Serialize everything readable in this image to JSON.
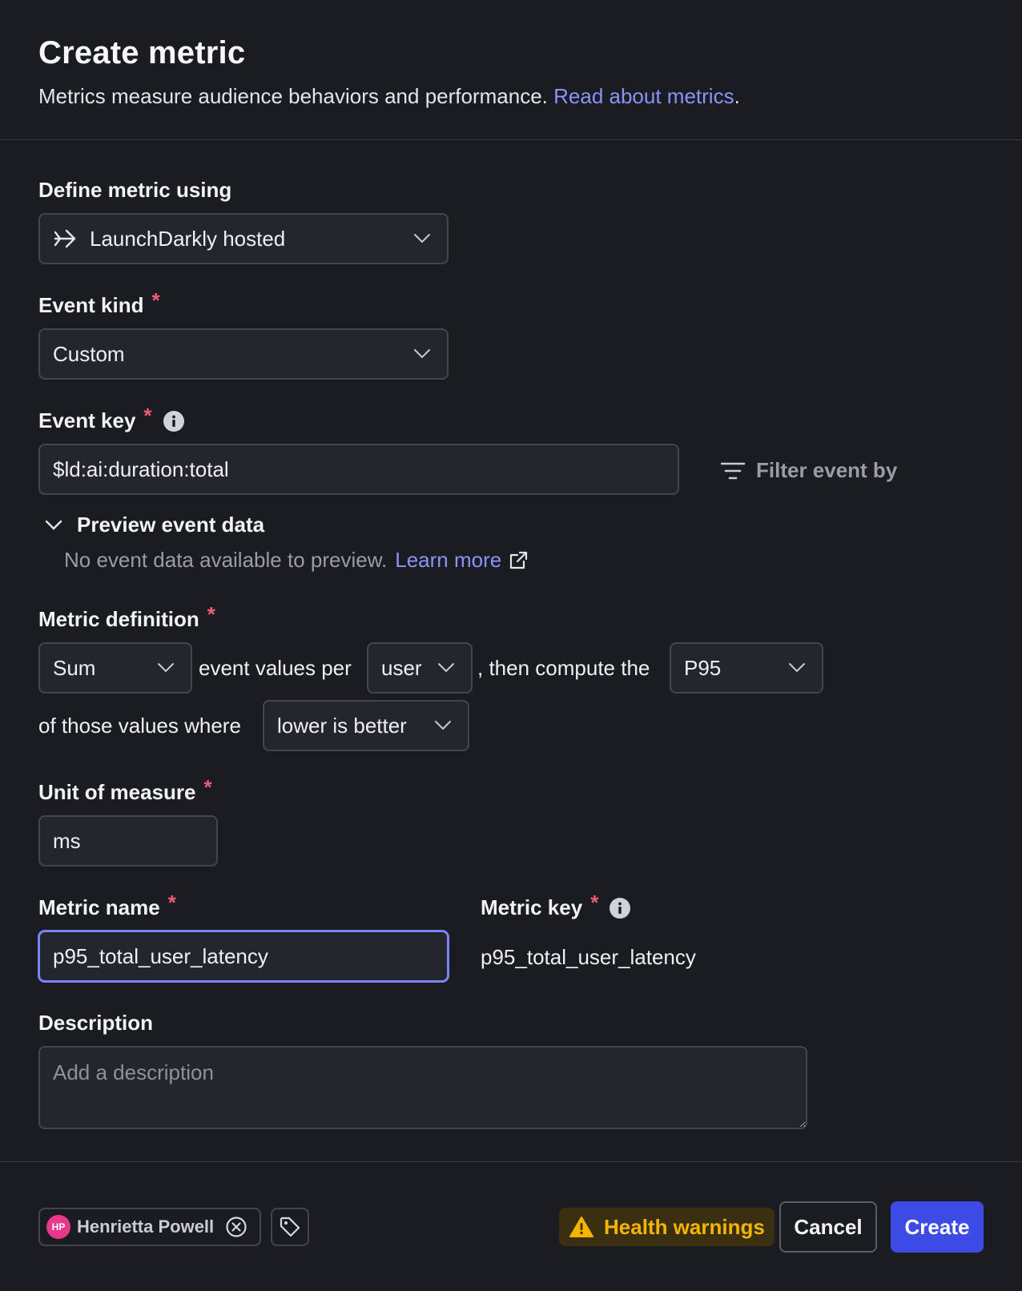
{
  "header": {
    "title": "Create metric",
    "subtitle": "Metrics measure audience behaviors and performance.",
    "subtitle_link": "Read about metrics",
    "subtitle_end": "."
  },
  "define": {
    "label": "Define metric using",
    "value": "LaunchDarkly hosted",
    "icon": "arrow-right-icon"
  },
  "event_kind": {
    "label": "Event kind",
    "required": "*",
    "value": "Custom"
  },
  "event_key": {
    "label": "Event key",
    "required": "*",
    "value": "$ld:ai:duration:total",
    "filter_label": "Filter event by"
  },
  "preview": {
    "label": "Preview event data",
    "message": "No event data available to preview.",
    "link": "Learn more"
  },
  "metric_definition": {
    "label": "Metric definition",
    "required": "*",
    "aggregation": "Sum",
    "text1": "event values per",
    "unit": "user",
    "text2": ", then compute the",
    "statistic": "P95",
    "text3": "of those values where",
    "direction": "lower is better"
  },
  "unit_of_measure": {
    "label": "Unit of measure",
    "required": "*",
    "value": "ms"
  },
  "metric_name": {
    "label": "Metric name",
    "required": "*",
    "value": "p95_total_user_latency"
  },
  "metric_key": {
    "label": "Metric key",
    "required": "*",
    "value": "p95_total_user_latency"
  },
  "description": {
    "label": "Description",
    "placeholder": "Add a description"
  },
  "footer": {
    "maintainer_initials": "HP",
    "maintainer_name": "Henrietta Powell",
    "health_warnings": "Health warnings",
    "cancel": "Cancel",
    "create": "Create"
  },
  "colors": {
    "background": "#1b1c22",
    "accent_link": "#8a93f8",
    "primary_button": "#3d4be6",
    "required_star": "#f05a78",
    "warning": "#f4b400",
    "avatar": "#e6398c"
  }
}
